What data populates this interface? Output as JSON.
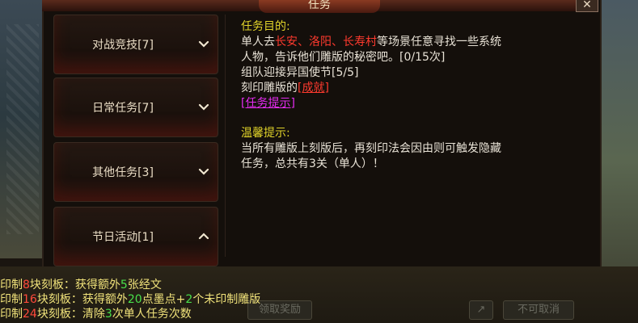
{
  "window": {
    "title": "任务",
    "close_label": "✕"
  },
  "menu": {
    "items": [
      {
        "label": "对战竞技[7]",
        "expanded": false
      },
      {
        "label": "日常任务[7]",
        "expanded": false
      },
      {
        "label": "其他任务[3]",
        "expanded": false
      },
      {
        "label": "节日活动[1]",
        "expanded": true
      }
    ]
  },
  "task": {
    "goal_heading": "任务目的:",
    "line1_a": "单人去",
    "loc1": "长安",
    "sep1": "、",
    "loc2": "洛阳",
    "sep2": "、",
    "loc3": "长寿村",
    "line1_b": "等场景任意寻找一些系统",
    "line2": "人物，告诉他们雕版的秘密吧。[0/15次]",
    "line3": "组队迎接异国使节[5/5]",
    "line4_a": "刻印雕版的",
    "achievement_link": "[成就]",
    "hint_link": "[任务提示]",
    "tip_heading": "温馨提示:",
    "tip1": "当所有雕版上刻版后，再刻印法会因由则可触发隐藏",
    "tip2": "任务，总共有3关（单人）！"
  },
  "rewards": [
    {
      "prefix": "印制",
      "count": "8",
      "mid": "块刻板：获得额外",
      "amount": "5",
      "suffix": "张经文"
    },
    {
      "prefix": "印制",
      "count": "16",
      "mid": "块刻板：获得额外",
      "amount": "20",
      "mid2": "点墨点+",
      "amount2": "2",
      "suffix": "个未印制雕版"
    },
    {
      "prefix": "印制",
      "count": "24",
      "mid": "块刻板：清除",
      "amount": "3",
      "suffix": "次单人任务次数"
    }
  ],
  "bottom_buttons": {
    "cancel": "不可取消",
    "share_icon": "share-icon",
    "faded": "领取奖励"
  },
  "colors": {
    "heading": "#e2d42a",
    "location": "#ff3a2e",
    "hint": "#e42cf0",
    "green": "#49e04a"
  }
}
